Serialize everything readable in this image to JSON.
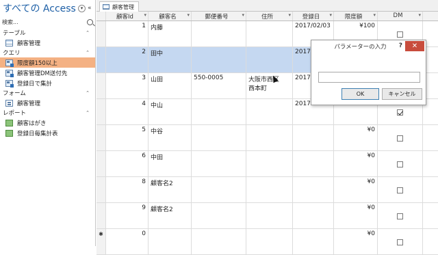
{
  "nav": {
    "title": "すべての Access...",
    "search_label": "検索...",
    "groups": [
      {
        "label": "テーブル",
        "items": [
          {
            "label": "顧客管理",
            "icon": "table-icon"
          }
        ]
      },
      {
        "label": "クエリ",
        "items": [
          {
            "label": "限度額150以上",
            "icon": "query-icon",
            "selected": true
          },
          {
            "label": "顧客管理DM送付先",
            "icon": "query-icon"
          },
          {
            "label": "登録日で集計",
            "icon": "query-icon"
          }
        ]
      },
      {
        "label": "フォーム",
        "items": [
          {
            "label": "顧客管理",
            "icon": "form-icon"
          }
        ]
      },
      {
        "label": "レポート",
        "items": [
          {
            "label": "顧客はがき",
            "icon": "report-icon"
          },
          {
            "label": "登録日毎集計表",
            "icon": "report-icon"
          }
        ]
      }
    ]
  },
  "tab": {
    "label": "顧客管理"
  },
  "grid": {
    "headers": [
      "顧客Id",
      "顧客名",
      "郵便番号",
      "住所",
      "登録日",
      "限度額",
      "DM"
    ],
    "rows": [
      {
        "id": "1",
        "name": "内藤",
        "zip": "",
        "addr1": "",
        "addr2": "",
        "date": "2017/02/03",
        "limit": "¥100",
        "dm": false
      },
      {
        "id": "2",
        "name": "田中",
        "zip": "",
        "addr1": "",
        "addr2": "",
        "date": "2017",
        "limit": "",
        "dm": false
      },
      {
        "id": "3",
        "name": "山田",
        "zip": "550-0005",
        "addr1": "大阪市西区",
        "addr2": "西本町",
        "date": "2017",
        "limit": "",
        "dm": false
      },
      {
        "id": "4",
        "name": "中山",
        "zip": "",
        "addr1": "",
        "addr2": "",
        "date": "2017",
        "limit": "",
        "dm": true
      },
      {
        "id": "5",
        "name": "中谷",
        "zip": "",
        "addr1": "",
        "addr2": "",
        "date": "",
        "limit": "¥0",
        "dm": false
      },
      {
        "id": "6",
        "name": "中田",
        "zip": "",
        "addr1": "",
        "addr2": "",
        "date": "",
        "limit": "¥0",
        "dm": false
      },
      {
        "id": "8",
        "name": "顧客名2",
        "zip": "",
        "addr1": "",
        "addr2": "",
        "date": "",
        "limit": "¥0",
        "dm": false
      },
      {
        "id": "9",
        "name": "顧客名2",
        "zip": "",
        "addr1": "",
        "addr2": "",
        "date": "",
        "limit": "¥0",
        "dm": false
      },
      {
        "id": "0",
        "name": "",
        "zip": "",
        "addr1": "",
        "addr2": "",
        "date": "",
        "limit": "¥0",
        "dm": false,
        "new_row": true
      }
    ],
    "new_row_marker": "✱"
  },
  "dialog": {
    "title": "パラメーターの入力",
    "help": "?",
    "close": "✕",
    "input_value": "",
    "ok_label": "OK",
    "cancel_label": "キャンセル"
  },
  "colors": {
    "selected_nav": "#f4b183",
    "selected_row": "#c5d8f1",
    "title": "#1d5fa6",
    "close": "#c84c3c"
  }
}
